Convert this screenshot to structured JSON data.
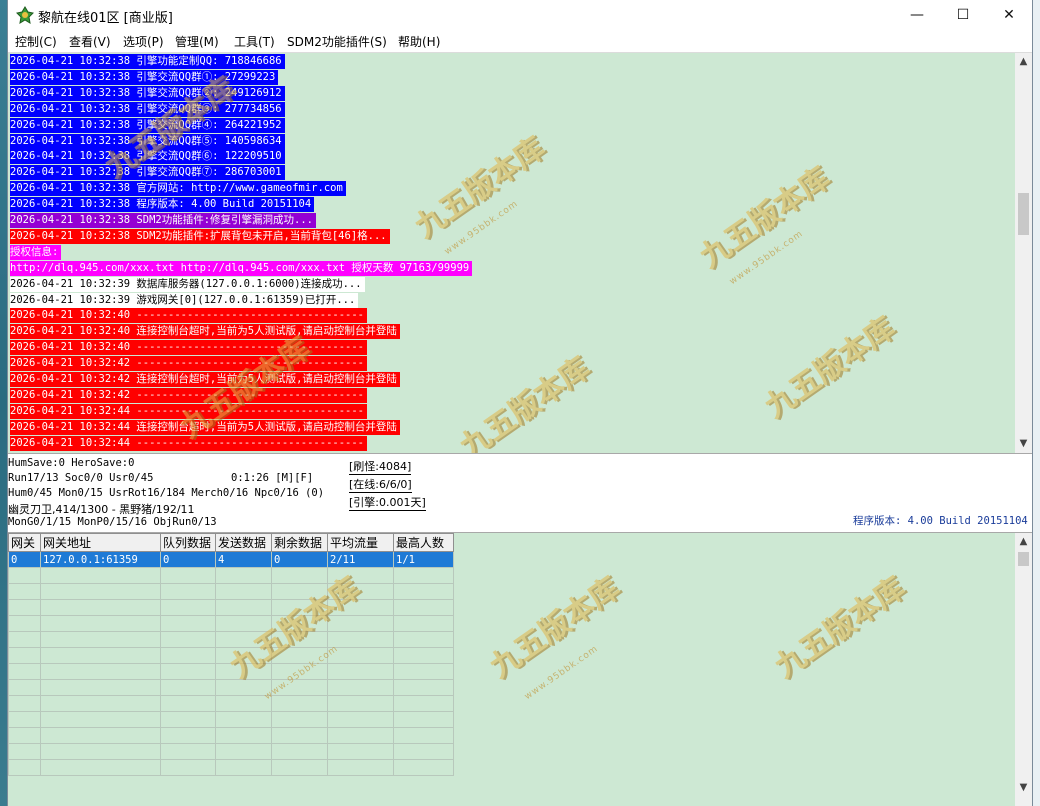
{
  "window": {
    "title": "黎航在线01区 [商业版]",
    "controls": {
      "minimize": "—",
      "maximize": "☐",
      "close": "✕"
    }
  },
  "menu": [
    "控制(C)",
    "查看(V)",
    "选项(P)",
    "管理(M)",
    "工具(T)",
    "SDM2功能插件(S)",
    "帮助(H)"
  ],
  "log": [
    {
      "text": "2026-04-21 10:32:38 引擎功能定制QQ: 718846686",
      "bg": "#0000ff",
      "fg": "#ffffff"
    },
    {
      "text": "2026-04-21 10:32:38 引擎交流QQ群①: 27299223",
      "bg": "#0000ff",
      "fg": "#ffffff"
    },
    {
      "text": "2026-04-21 10:32:38 引擎交流QQ群②: 249126912",
      "bg": "#0000ff",
      "fg": "#ffffff"
    },
    {
      "text": "2026-04-21 10:32:38 引擎交流QQ群③: 277734856",
      "bg": "#0000ff",
      "fg": "#ffffff"
    },
    {
      "text": "2026-04-21 10:32:38 引擎交流QQ群④: 264221952",
      "bg": "#0000ff",
      "fg": "#ffffff"
    },
    {
      "text": "2026-04-21 10:32:38 引擎交流QQ群⑤: 140598634",
      "bg": "#0000ff",
      "fg": "#ffffff"
    },
    {
      "text": "2026-04-21 10:32:38 引擎交流QQ群⑥: 122209510",
      "bg": "#0000ff",
      "fg": "#ffffff"
    },
    {
      "text": "2026-04-21 10:32:38 引擎交流QQ群⑦: 286703001",
      "bg": "#0000ff",
      "fg": "#ffffff"
    },
    {
      "text": "2026-04-21 10:32:38 官方网站: http://www.gameofmir.com",
      "bg": "#0000ff",
      "fg": "#ffffff"
    },
    {
      "text": "2026-04-21 10:32:38 程序版本: 4.00 Build 20151104",
      "bg": "#0000ff",
      "fg": "#ffffff"
    },
    {
      "text": "2026-04-21 10:32:38 SDM2功能插件:修复引擎漏洞成功...",
      "bg": "#9400d3",
      "fg": "#ffffff"
    },
    {
      "text": "2026-04-21 10:32:38 SDM2功能插件:扩展背包未开启,当前背包[46]格...",
      "bg": "#ff0000",
      "fg": "#ffffff"
    },
    {
      "text": "授权信息:",
      "bg": "#ff00ff",
      "fg": "#ffffff"
    },
    {
      "text": "http://dlq.945.com/xxx.txt http://dlq.945.com/xxx.txt 授权天数 97163/99999",
      "bg": "#ff00ff",
      "fg": "#ffffff"
    },
    {
      "text": "2026-04-21 10:32:39 数据库服务器(127.0.0.1:6000)连接成功...",
      "bg": "#ffffff",
      "fg": "#000000"
    },
    {
      "text": "2026-04-21 10:32:39 游戏网关[0](127.0.0.1:61359)已打开...",
      "bg": "#ffffff",
      "fg": "#000000"
    },
    {
      "text": "2026-04-21 10:32:40 ------------------------------------",
      "bg": "#ff0000",
      "fg": "#ffffff"
    },
    {
      "text": "2026-04-21 10:32:40 连接控制台超时,当前为5人测试版,请启动控制台并登陆",
      "bg": "#ff0000",
      "fg": "#ffffff"
    },
    {
      "text": "2026-04-21 10:32:40 ------------------------------------",
      "bg": "#ff0000",
      "fg": "#ffffff"
    },
    {
      "text": "2026-04-21 10:32:42 ------------------------------------",
      "bg": "#ff0000",
      "fg": "#ffffff"
    },
    {
      "text": "2026-04-21 10:32:42 连接控制台超时,当前为5人测试版,请启动控制台并登陆",
      "bg": "#ff0000",
      "fg": "#ffffff"
    },
    {
      "text": "2026-04-21 10:32:42 ------------------------------------",
      "bg": "#ff0000",
      "fg": "#ffffff"
    },
    {
      "text": "2026-04-21 10:32:44 ------------------------------------",
      "bg": "#ff0000",
      "fg": "#ffffff"
    },
    {
      "text": "2026-04-21 10:32:44 连接控制台超时,当前为5人测试版,请启动控制台并登陆",
      "bg": "#ff0000",
      "fg": "#ffffff"
    },
    {
      "text": "2026-04-21 10:32:44 ------------------------------------",
      "bg": "#ff0000",
      "fg": "#ffffff"
    }
  ],
  "status": {
    "line1": "HumSave:0 HeroSave:0",
    "line2": "Run17/13 Soc0/0 Usr0/45",
    "time": "0:1:26 [M][F]",
    "line3": "Hum0/45 Mon0/15 UsrRot16/184 Merch0/16 Npc0/16 (0)",
    "line4": "幽灵刀卫,414/1300 - 黑野猪/192/11",
    "line5": "MonG0/1/15 MonP0/15/16 ObjRun0/13",
    "refresh": "[刷怪:4084]",
    "online": "[在线:6/6/0]",
    "engine": "[引擎:0.001天]",
    "version": "程序版本: 4.00 Build 20151104"
  },
  "grid": {
    "headers": [
      "网关",
      "网关地址",
      "队列数据",
      "发送数据",
      "剩余数据",
      "平均流量",
      "最高人数"
    ],
    "rows": [
      [
        "0",
        "127.0.0.1:61359",
        "0",
        "4",
        "0",
        "2/11",
        "1/1"
      ]
    ]
  },
  "watermark": {
    "text": "九五版本库",
    "sub": "www.95bbk.com"
  },
  "colors": {
    "log_bg": "#cde8d3",
    "selection": "#1e7ad6"
  }
}
